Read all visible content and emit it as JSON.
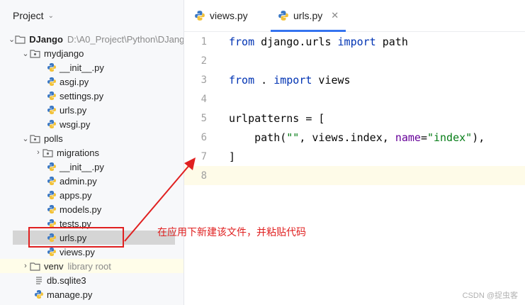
{
  "project_header": {
    "title": "Project"
  },
  "tree": {
    "root": {
      "name": "DJango",
      "path": "D:\\A0_Project\\Python\\DJango"
    },
    "mydjango": {
      "name": "mydjango"
    },
    "mydjango_files": [
      "__init__.py",
      "asgi.py",
      "settings.py",
      "urls.py",
      "wsgi.py"
    ],
    "polls": {
      "name": "polls"
    },
    "migrations": {
      "name": "migrations"
    },
    "polls_files": [
      "__init__.py",
      "admin.py",
      "apps.py",
      "models.py",
      "tests.py",
      "urls.py",
      "views.py"
    ],
    "venv": {
      "name": "venv",
      "note": "library root"
    },
    "db": {
      "name": "db.sqlite3"
    },
    "manage": {
      "name": "manage.py"
    }
  },
  "tabs": [
    {
      "label": "views.py",
      "active": false
    },
    {
      "label": "urls.py",
      "active": true
    }
  ],
  "editor": {
    "line_numbers": [
      "1",
      "2",
      "3",
      "4",
      "5",
      "6",
      "7",
      "8"
    ],
    "line1": {
      "kw1": "from",
      "mod": " django.urls ",
      "kw2": "import",
      "name": " path"
    },
    "line3": {
      "kw1": "from",
      "mod": " . ",
      "kw2": "import",
      "name": " views"
    },
    "line5": {
      "text": "urlpatterns = ["
    },
    "line6": {
      "pre": "    path(",
      "s1": "\"\"",
      "mid": ", views.index, ",
      "param": "name",
      "eq": "=",
      "s2": "\"index\"",
      "post": "),"
    },
    "line7": {
      "text": "]"
    }
  },
  "annotation": {
    "text": "在应用下新建该文件，并粘贴代码"
  },
  "watermark": {
    "text": "CSDN @捉虫客"
  },
  "colors": {
    "annotation": "#e02020",
    "keyword": "#0033b3",
    "string": "#067d17",
    "param": "#660099",
    "tab_underline": "#3574f0"
  }
}
